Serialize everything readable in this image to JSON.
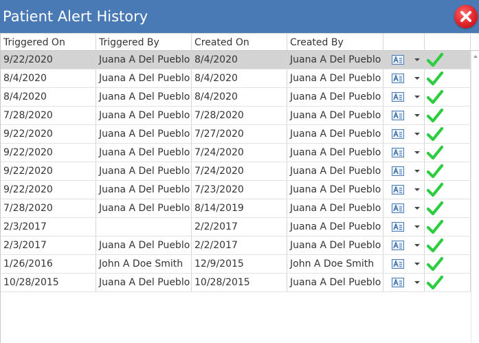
{
  "window": {
    "title": "Patient Alert History",
    "close_icon": "close-x-icon",
    "title_bar_color": "#4a7ab5"
  },
  "table": {
    "columns": [
      "Triggered On",
      "Triggered By",
      "Created On",
      "Created By",
      "",
      ""
    ],
    "rows": [
      {
        "triggered_on": "9/22/2020",
        "triggered_by": "Juana A Del Pueblo",
        "created_on": "8/4/2020",
        "created_by": "Juana A Del Pueblo",
        "selected": true
      },
      {
        "triggered_on": "8/4/2020",
        "triggered_by": "Juana A Del Pueblo",
        "created_on": "8/4/2020",
        "created_by": "Juana A Del Pueblo"
      },
      {
        "triggered_on": "8/4/2020",
        "triggered_by": "Juana A Del Pueblo",
        "created_on": "8/4/2020",
        "created_by": "Juana A Del Pueblo"
      },
      {
        "triggered_on": "7/28/2020",
        "triggered_by": "Juana A Del Pueblo",
        "created_on": "7/28/2020",
        "created_by": "Juana A Del Pueblo"
      },
      {
        "triggered_on": "9/22/2020",
        "triggered_by": "Juana A Del Pueblo",
        "created_on": "7/27/2020",
        "created_by": "Juana A Del Pueblo"
      },
      {
        "triggered_on": "9/22/2020",
        "triggered_by": "Juana A Del Pueblo",
        "created_on": "7/24/2020",
        "created_by": "Juana A Del Pueblo"
      },
      {
        "triggered_on": "9/22/2020",
        "triggered_by": "Juana A Del Pueblo",
        "created_on": "7/24/2020",
        "created_by": "Juana A Del Pueblo"
      },
      {
        "triggered_on": "9/22/2020",
        "triggered_by": "Juana A Del Pueblo",
        "created_on": "7/23/2020",
        "created_by": "Juana A Del Pueblo"
      },
      {
        "triggered_on": "7/28/2020",
        "triggered_by": "Juana A Del Pueblo",
        "created_on": "8/14/2019",
        "created_by": "Juana A Del Pueblo"
      },
      {
        "triggered_on": "2/3/2017",
        "triggered_by": "",
        "created_on": "2/2/2017",
        "created_by": "Juana A Del Pueblo"
      },
      {
        "triggered_on": "2/3/2017",
        "triggered_by": "Juana A Del Pueblo",
        "created_on": "2/2/2017",
        "created_by": "Juana A Del Pueblo"
      },
      {
        "triggered_on": "1/26/2016",
        "triggered_by": "John A Doe Smith",
        "created_on": "12/9/2015",
        "created_by": "John A Doe Smith"
      },
      {
        "triggered_on": "10/28/2015",
        "triggered_by": "Juana A Del Pueblo",
        "created_on": "10/28/2015",
        "created_by": "Juana A Del Pueblo"
      }
    ],
    "row_icons": {
      "attachment": "text-document-icon",
      "dropdown": "chevron-down-icon",
      "status": "green-check-icon"
    },
    "colors": {
      "selected_row": "#d3d3d3",
      "check": "#2ecc40"
    }
  }
}
